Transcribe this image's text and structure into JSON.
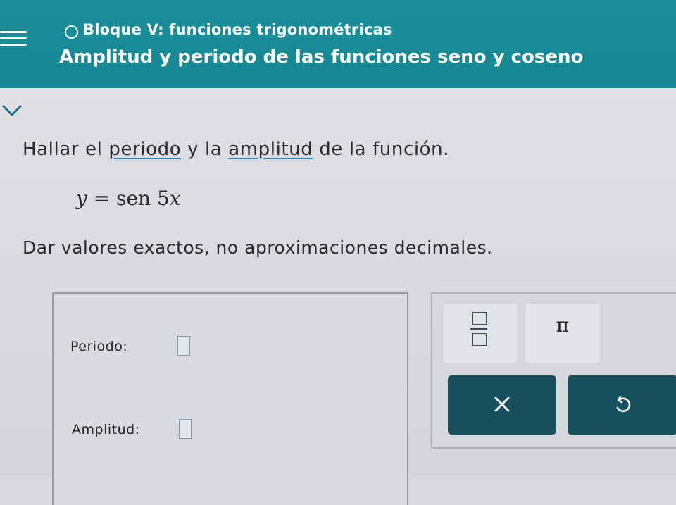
{
  "header": {
    "unit_title": "Bloque V: funciones trigonométricas",
    "lesson_title": "Amplitud y periodo de las funciones seno y coseno"
  },
  "question": {
    "prompt_before": "Hallar el ",
    "term_period": "periodo",
    "prompt_middle": " y la ",
    "term_amplitude": "amplitud",
    "prompt_after": " de la función.",
    "equation_lhs": "y",
    "equation_equals": " = ",
    "equation_func": "sen",
    "equation_coef": " 5",
    "equation_var": "x",
    "instruction": "Dar valores exactos, no aproximaciones decimales."
  },
  "answers": {
    "period_label": "Periodo:",
    "period_value": "",
    "amplitude_label": "Amplitud:",
    "amplitude_value": ""
  },
  "tools": {
    "fraction": "fraction-icon",
    "pi_label": "π",
    "clear": "x-icon",
    "undo": "undo-icon"
  },
  "colors": {
    "header_bg": "#168894",
    "action_btn_bg": "#16505e",
    "link_underline": "#3a7fb5"
  }
}
